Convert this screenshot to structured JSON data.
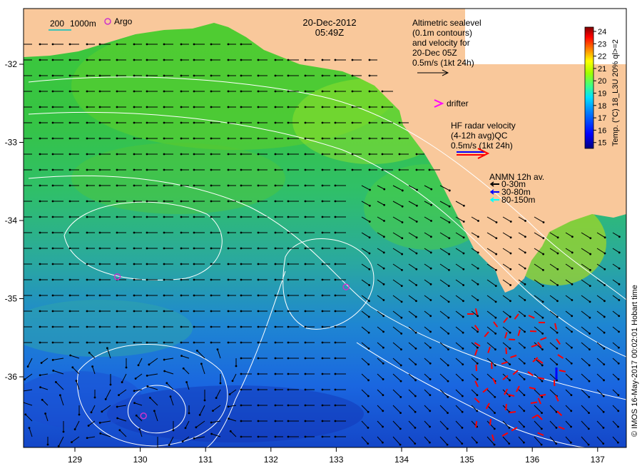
{
  "header": {
    "date": "20-Dec-2012",
    "time": "05:49Z"
  },
  "scale_legend": {
    "label_a": "200",
    "label_b": "1000m",
    "argo_label": "Argo"
  },
  "altimetry_legend": {
    "line1": "Altimetric sealevel",
    "line2": "(0.1m contours)",
    "line3": "and velocity for",
    "line4": "20-Dec 05Z",
    "line5": "0.5m/s (1kt 24h)"
  },
  "drifter_legend": {
    "label": "drifter"
  },
  "hf_radar_legend": {
    "line1": "HF radar velocity",
    "line2": "(4-12h avg)QC",
    "line3": "0.5m/s (1kt 24h)"
  },
  "anmn_legend": {
    "title": "ANMN 12h av.",
    "items": [
      {
        "label": "0-30m",
        "color": "#000000"
      },
      {
        "label": "30-80m",
        "color": "#0000ff"
      },
      {
        "label": "80-150m",
        "color": "#00ffff"
      }
    ]
  },
  "colorbar": {
    "title": "Temp. (°C) 18_L3U 20% ql>=2",
    "ticks": [
      "24",
      "23",
      "22",
      "21",
      "20",
      "19",
      "18",
      "17",
      "16",
      "15"
    ]
  },
  "axes": {
    "x_ticks": [
      "129",
      "130",
      "131",
      "132",
      "133",
      "134",
      "135",
      "136",
      "137"
    ],
    "y_ticks": [
      "-32",
      "-33",
      "-34",
      "-35",
      "-36"
    ]
  },
  "argo_floats": [
    {
      "lon": 129.65,
      "lat": -34.72
    },
    {
      "lon": 133.15,
      "lat": -34.85
    },
    {
      "lon": 130.05,
      "lat": -36.5
    }
  ],
  "footer": {
    "credit": "© IMOS 16-May-2017 00:02:01 Hobart time"
  },
  "colors": {
    "land": "#f9c89b",
    "legend_box": "#ffffff",
    "argo": "#cc33cc",
    "drifter": "#ff00ff",
    "hf_radar_red": "#ff0000",
    "hf_radar_blue": "#0000ff"
  }
}
